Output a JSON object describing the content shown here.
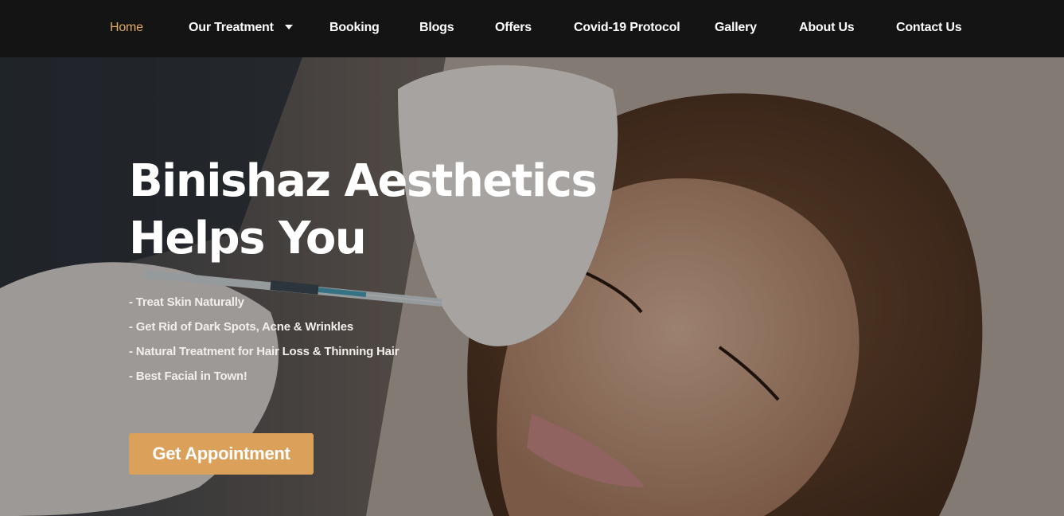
{
  "nav": {
    "items": [
      {
        "label": "Home"
      },
      {
        "label": "Our Treatment"
      },
      {
        "label": "Booking"
      },
      {
        "label": "Blogs"
      },
      {
        "label": "Offers"
      },
      {
        "label": "Covid-19 Protocol"
      },
      {
        "label": "Gallery"
      },
      {
        "label": "About Us"
      },
      {
        "label": "Contact Us"
      }
    ]
  },
  "hero": {
    "title_line1": "Binishaz Aesthetics",
    "title_line2": "Helps You",
    "features": [
      "- Treat Skin Naturally",
      "- Get Rid of Dark Spots, Acne & Wrinkles",
      "- Natural Treatment for Hair Loss & Thinning Hair",
      "- Best Facial in Town!"
    ],
    "cta_label": "Get Appointment"
  },
  "colors": {
    "nav_bg": "#141414",
    "nav_active": "#e0a964",
    "cta_bg": "#dba15b"
  }
}
